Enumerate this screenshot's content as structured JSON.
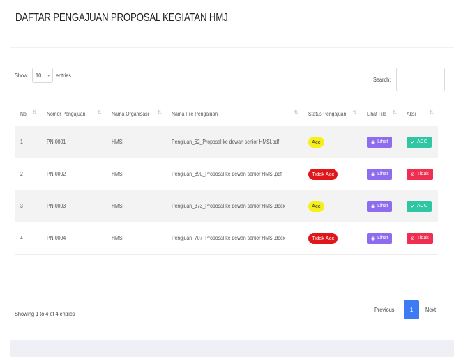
{
  "page_title": "DAFTAR PENGAJUAN PROPOSAL KEGIATAN HMJ",
  "length_menu": {
    "show_label": "Show",
    "value": "10",
    "entries_label": "entries"
  },
  "search": {
    "label": "Search:",
    "value": ""
  },
  "table": {
    "headers": [
      "No.",
      "Nomor Pengajuan",
      "Nama Organisasi",
      "Nama File Pengajuan",
      "Status Pengajuan",
      "Lihat File",
      "Aksi"
    ],
    "rows": [
      {
        "no": "1",
        "nomor": "PN-0001",
        "organisasi": "HMSI",
        "file": "Pengjuan_62_Proposal ke dewan senior HMSI.pdf",
        "status": "Acc",
        "status_type": "acc",
        "lihat": "Lihat",
        "aksi": "ACC",
        "aksi_type": "acc"
      },
      {
        "no": "2",
        "nomor": "PN-0002",
        "organisasi": "HMSI",
        "file": "Pengjuan_890_Proposal ke dewan senior HMSI.pdf",
        "status": "Tidak Acc",
        "status_type": "tidak",
        "lihat": "Lihat",
        "aksi": "Tidak",
        "aksi_type": "tidak"
      },
      {
        "no": "3",
        "nomor": "PN-0003",
        "organisasi": "HMSI",
        "file": "Pengjuan_373_Proposal ke dewan senior HMSI.docx",
        "status": "Acc",
        "status_type": "acc",
        "lihat": "Lihat",
        "aksi": "ACC",
        "aksi_type": "acc"
      },
      {
        "no": "4",
        "nomor": "PN-0004",
        "organisasi": "HMSI",
        "file": "Pengjuan_707_Proposal ke dewan senior HMSI.docx",
        "status": "Tidak Acc",
        "status_type": "tidak",
        "lihat": "Lihat",
        "aksi": "Tidak",
        "aksi_type": "tidak"
      }
    ]
  },
  "info": "Showing 1 to 4 of 4 entries",
  "pagination": {
    "previous": "Previous",
    "current": "1",
    "next": "Next"
  },
  "colors": {
    "acc_badge": "#f7ef1a",
    "tidak_badge": "#e0161b",
    "lihat_button": "#8e6cf0",
    "acc_button": "#2fc6a3",
    "tidak_button": "#ee2f52",
    "active_page": "#3d7bf5"
  }
}
